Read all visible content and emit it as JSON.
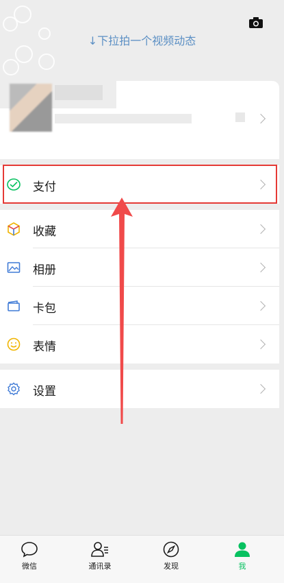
{
  "header": {
    "pull_hint": "↓下拉拍一个视频动态"
  },
  "menu": {
    "pay_label": "支付",
    "favorites_label": "收藏",
    "album_label": "相册",
    "cards_label": "卡包",
    "stickers_label": "表情",
    "settings_label": "设置"
  },
  "tabbar": {
    "chats_label": "微信",
    "contacts_label": "通讯录",
    "discover_label": "发现",
    "me_label": "我",
    "active_tab": "me"
  },
  "colors": {
    "accent": "#07c160",
    "hint_text": "#5b8fc4",
    "highlight_border": "#e53935",
    "arrow": "#f04a4a",
    "background": "#ededed"
  }
}
